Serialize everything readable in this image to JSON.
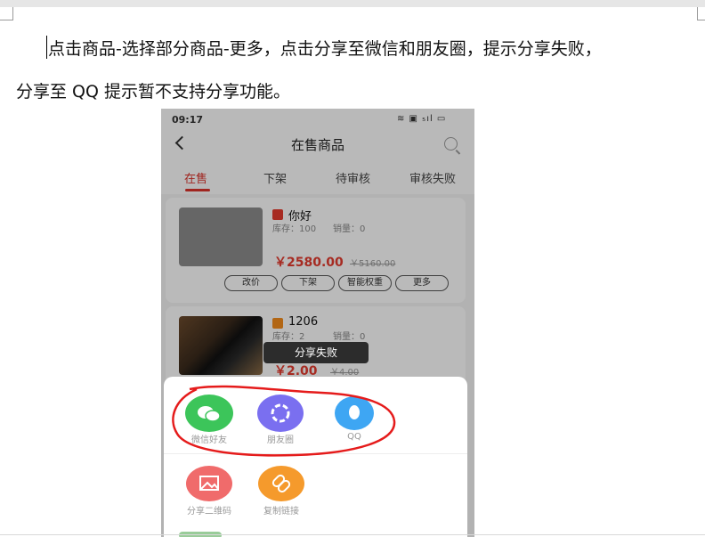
{
  "document": {
    "line1": "点击商品-选择部分商品-更多，点击分享至微信和朋友圈，提示分享失败，",
    "line2": "分享至 QQ 提示暂不支持分享功能。"
  },
  "phone": {
    "status_time": "09:17",
    "status_icons": "≋ ▣ ₅ıl ▭",
    "title": "在售商品",
    "tabs": [
      "在售",
      "下架",
      "待审核",
      "审核失败"
    ],
    "products": [
      {
        "name": "你好",
        "stock": "库存：100",
        "sales": "销量：0",
        "price": "￥2580.00",
        "original_price": "￥5160.00",
        "badge_color": "#e23b2e"
      },
      {
        "name": "1206",
        "stock": "库存：2",
        "sales": "销量：0",
        "price": "￥2.00",
        "original_price": "￥4.00",
        "badge_color": "#f08a1c"
      }
    ],
    "buttons": [
      "改价",
      "下架",
      "智能权重",
      "更多"
    ],
    "toast": "分享失败",
    "share_options": [
      {
        "label": "微信好友",
        "icon": "wechat-icon",
        "color": "#3cc55a"
      },
      {
        "label": "朋友圈",
        "icon": "moments-icon",
        "color": "#7a6ff0"
      },
      {
        "label": "QQ",
        "icon": "qq-icon",
        "color": "#3ea6f3"
      },
      {
        "label": "分享二维码",
        "icon": "qrcode-image-icon",
        "color": "#f06b6b"
      },
      {
        "label": "复制链接",
        "icon": "link-icon",
        "color": "#f59a2c"
      }
    ],
    "annotation_color": "#e51b1b"
  }
}
